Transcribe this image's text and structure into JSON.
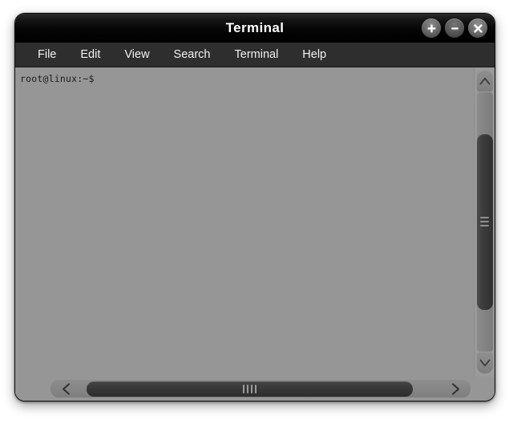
{
  "window": {
    "title": "Terminal",
    "controls": [
      {
        "name": "maximize-button",
        "glyph": "+",
        "label": "Maximize"
      },
      {
        "name": "minimize-button",
        "glyph": "−",
        "label": "Minimize"
      },
      {
        "name": "close-button",
        "glyph": "✕",
        "label": "Close"
      }
    ]
  },
  "menubar": {
    "items": [
      {
        "label": "File"
      },
      {
        "label": "Edit"
      },
      {
        "label": "View"
      },
      {
        "label": "Search"
      },
      {
        "label": "Terminal"
      },
      {
        "label": "Help"
      }
    ]
  },
  "terminal": {
    "prompt": "root@linux:~$",
    "lines": [
      "root@linux:~$"
    ],
    "background_color": "#969696",
    "text_color": "#1c1c1c"
  },
  "scrollbars": {
    "vertical": {
      "up_arrow_icon": "chevron-up-icon",
      "down_arrow_icon": "chevron-down-icon",
      "thumb_position_percent": 16,
      "thumb_size_percent": 68
    },
    "horizontal": {
      "left_arrow_icon": "chevron-left-icon",
      "right_arrow_icon": "chevron-right-icon",
      "thumb_position_percent": 2,
      "thumb_size_percent": 90
    }
  },
  "colors": {
    "titlebar": "#000000",
    "menubar": "#2e2e2e",
    "terminal_bg": "#969696",
    "page_bg": "#ffffff"
  }
}
